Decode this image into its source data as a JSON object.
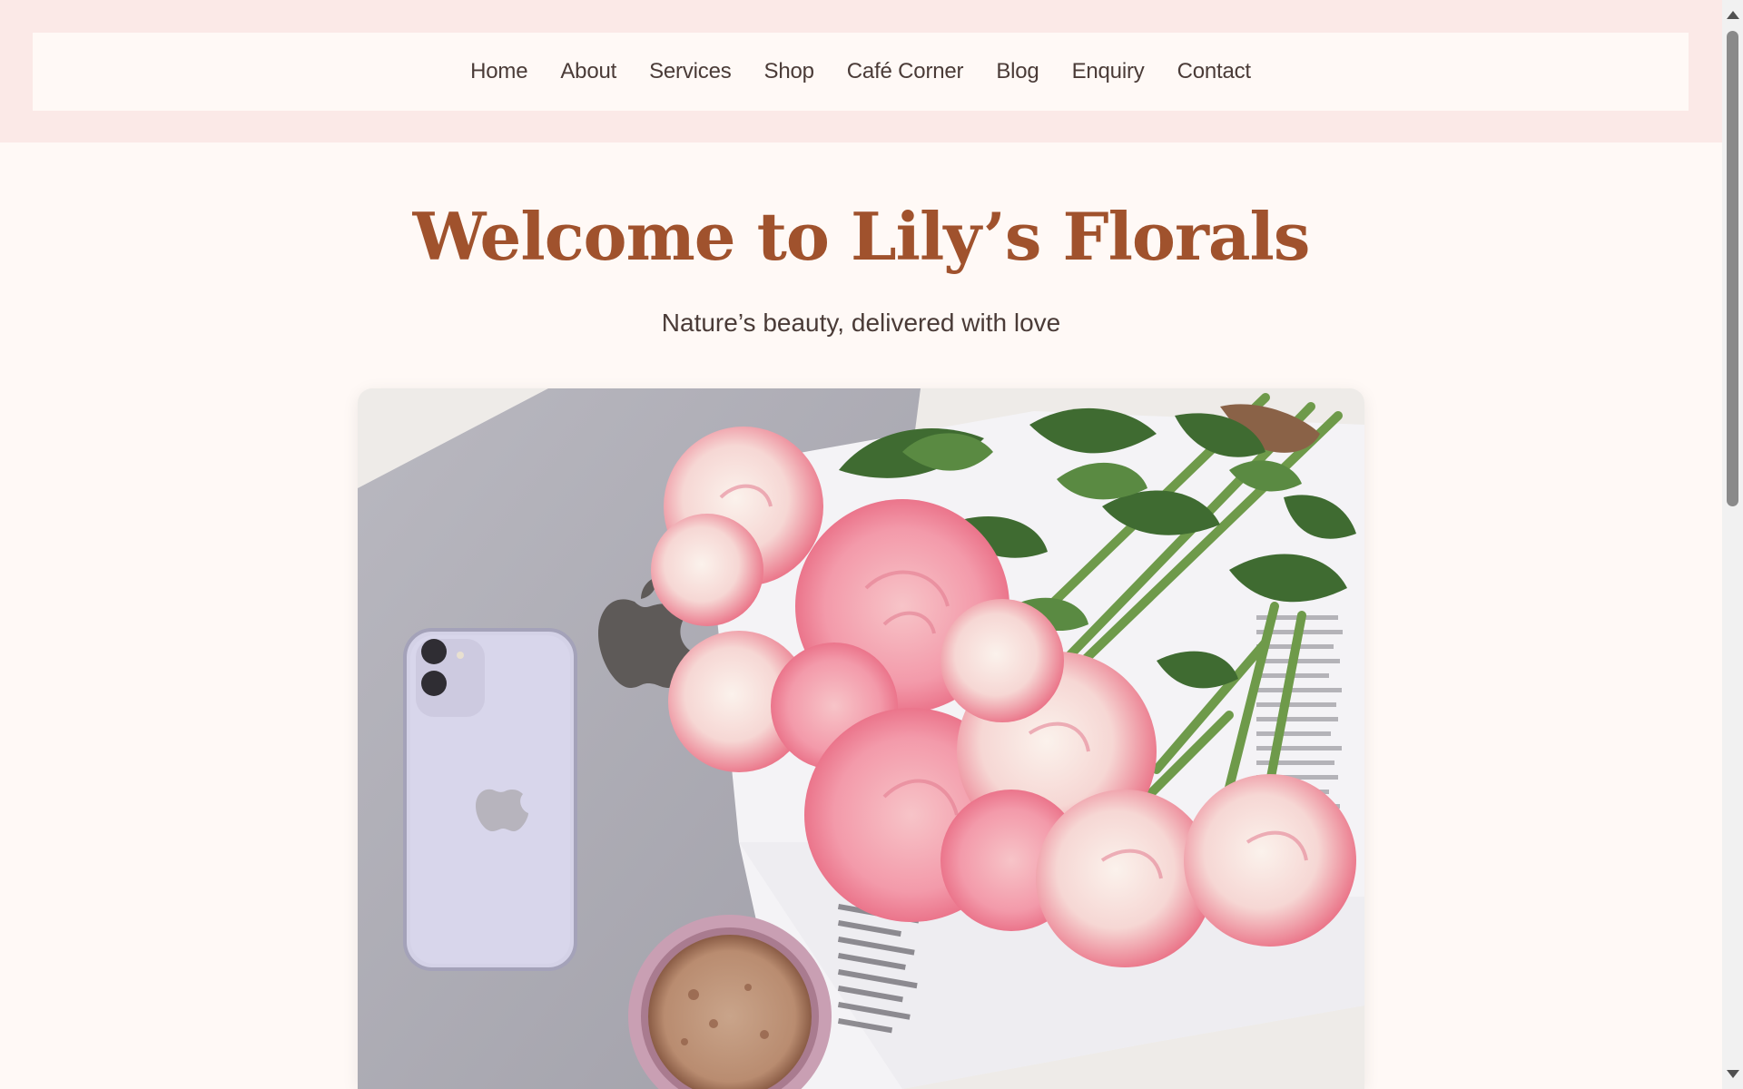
{
  "nav": {
    "items": [
      "Home",
      "About",
      "Services",
      "Shop",
      "Café Corner",
      "Blog",
      "Enquiry",
      "Contact"
    ]
  },
  "hero": {
    "title": "Welcome to Lily’s Florals",
    "subtitle": "Nature’s beauty, delivered with love"
  },
  "colors": {
    "brand_accent": "#a0522d",
    "header_band": "#fbe9e7",
    "page_background": "#fff9f6",
    "text": "#4a3b37"
  }
}
